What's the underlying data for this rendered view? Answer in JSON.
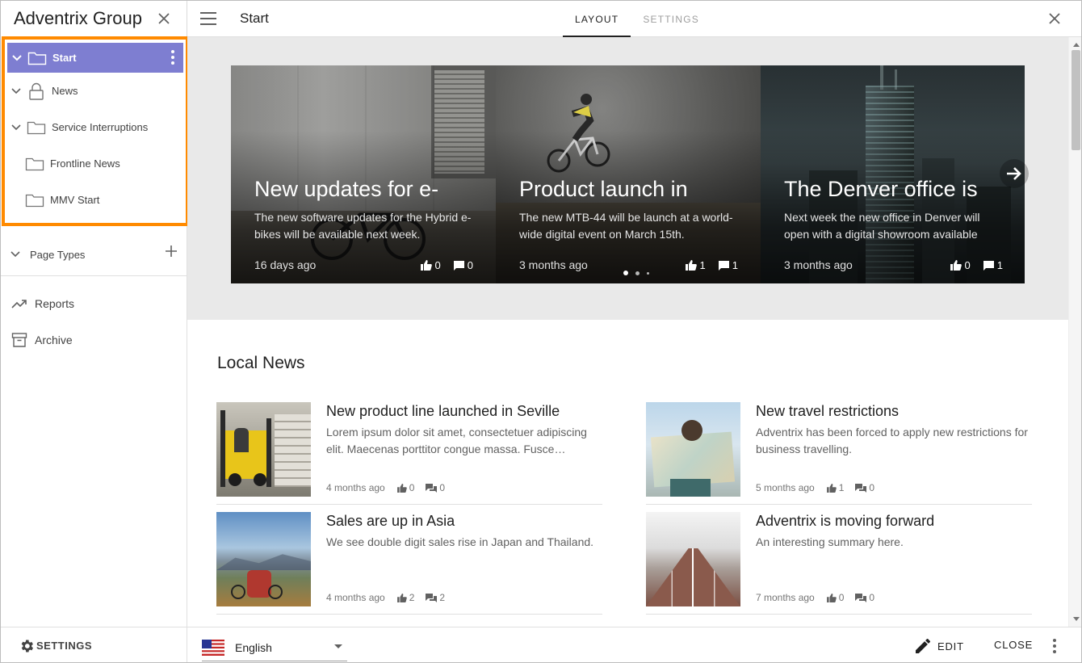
{
  "sidebar": {
    "title": "Adventrix Group",
    "tree": [
      {
        "label": "Start",
        "icon": "folder-icon",
        "active": true
      },
      {
        "label": "News",
        "icon": "lock-icon"
      },
      {
        "label": "Service Interruptions",
        "icon": "folder-icon"
      },
      {
        "label": "Frontline News",
        "icon": "folder-icon"
      },
      {
        "label": "MMV Start",
        "icon": "folder-icon"
      }
    ],
    "page_types": "Page Types",
    "links": [
      {
        "label": "Reports",
        "icon": "trending-up-icon"
      },
      {
        "label": "Archive",
        "icon": "archive-icon"
      }
    ],
    "settings_label": "SETTINGS"
  },
  "topbar": {
    "page_title": "Start",
    "tabs": [
      {
        "label": "LAYOUT",
        "active": true
      },
      {
        "label": "SETTINGS",
        "active": false
      }
    ]
  },
  "carousel": {
    "slides": [
      {
        "title": "New updates for e-",
        "text": "The new software updates for the Hybrid e-bikes will be available next week.",
        "date": "16 days ago",
        "likes": "0",
        "comments": "0"
      },
      {
        "title": "Product launch in",
        "text": "The new MTB-44 will be launch at a world-wide digital event on March 15th.",
        "date": "3 months ago",
        "likes": "1",
        "comments": "1"
      },
      {
        "title": "The Denver office is",
        "text": "Next week the new office in Denver will open with a digital showroom available",
        "date": "3 months ago",
        "likes": "0",
        "comments": "1"
      }
    ]
  },
  "local_news": {
    "title": "Local News",
    "items": [
      {
        "title": "New product line launched in Seville",
        "summary": "Lorem ipsum dolor sit amet, consectetuer adipiscing elit. Maecenas porttitor congue massa. Fusce…",
        "date": "4 months ago",
        "likes": "0",
        "comments": "0"
      },
      {
        "title": "New travel restrictions",
        "summary": "Adventrix has been forced to apply new restrictions for business travelling.",
        "date": "5 months ago",
        "likes": "1",
        "comments": "0"
      },
      {
        "title": "Sales are up in Asia",
        "summary": "We see double digit sales rise in Japan and Thailand.",
        "date": "4 months ago",
        "likes": "2",
        "comments": "2"
      },
      {
        "title": "Adventrix is moving forward",
        "summary": "An interesting summary here.",
        "date": "7 months ago",
        "likes": "0",
        "comments": "0"
      }
    ]
  },
  "bottombar": {
    "language": "English",
    "edit_label": "EDIT",
    "close_label": "CLOSE"
  },
  "colors": {
    "active_tree_bg": "#7e7ed1",
    "highlight_border": "#ff8a00"
  }
}
